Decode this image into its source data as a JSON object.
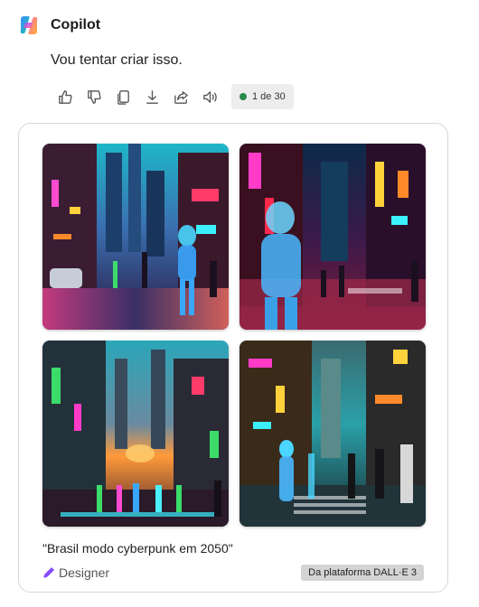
{
  "app": {
    "name": "Copilot"
  },
  "message": {
    "text": "Vou tentar criar isso."
  },
  "actions": {
    "items": [
      {
        "icon": "thumbs-up-icon"
      },
      {
        "icon": "thumbs-down-icon"
      },
      {
        "icon": "copy-icon"
      },
      {
        "icon": "download-icon"
      },
      {
        "icon": "share-icon"
      },
      {
        "icon": "speaker-icon"
      }
    ],
    "counter": "1 de 30",
    "counter_color": "#2a8a4a"
  },
  "card": {
    "images": [
      {
        "alt": "cyberpunk-street-1"
      },
      {
        "alt": "cyberpunk-street-2"
      },
      {
        "alt": "cyberpunk-street-3"
      },
      {
        "alt": "cyberpunk-street-4"
      }
    ],
    "prompt": "\"Brasil modo cyberpunk em 2050\"",
    "designer_label": "Designer",
    "badge": "Da plataforma DALL·E 3"
  }
}
